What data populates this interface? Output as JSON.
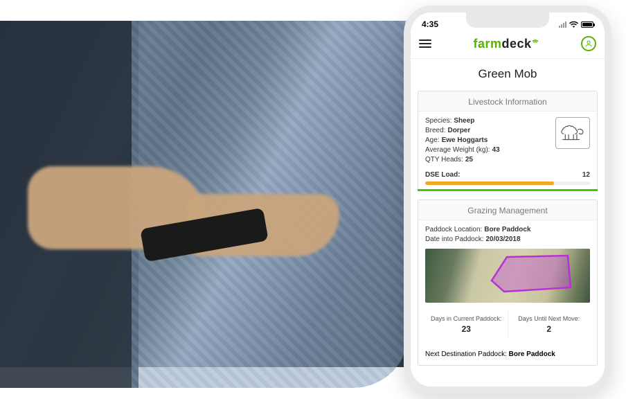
{
  "status": {
    "time": "4:35"
  },
  "brand": {
    "part1": "farm",
    "part2": "deck"
  },
  "page": {
    "title": "Green Mob"
  },
  "livestock": {
    "card_title": "Livestock Information",
    "species_label": "Species:",
    "species_value": "Sheep",
    "breed_label": "Breed:",
    "breed_value": "Dorper",
    "age_label": "Age:",
    "age_value": "Ewe Hoggarts",
    "avg_weight_label": "Average Weight (kg):",
    "avg_weight_value": "43",
    "qty_label": "QTY Heads:",
    "qty_value": "25",
    "dse_label": "DSE Load:",
    "dse_value": "12"
  },
  "grazing": {
    "card_title": "Grazing Management",
    "location_label": "Paddock Location:",
    "location_value": "Bore Paddock",
    "date_in_label": "Date into Paddock:",
    "date_in_value": "20/03/2018",
    "days_current_label": "Days in Current Paddock:",
    "days_current_value": "23",
    "days_until_label": "Days Until Next Move:",
    "days_until_value": "2",
    "next_dest_label": "Next Destination Paddock:",
    "next_dest_value": "Bore Paddock"
  },
  "colors": {
    "accent": "#59b100",
    "warn": "#f5a623",
    "shape": "#b830d6"
  }
}
